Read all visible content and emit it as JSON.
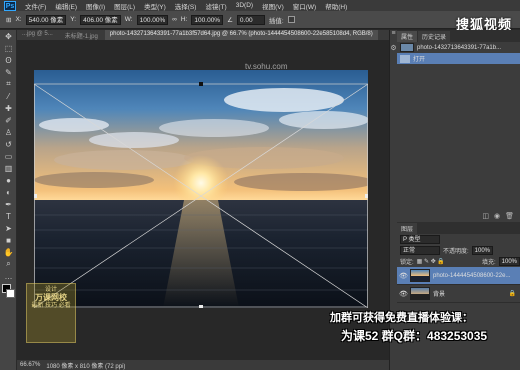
{
  "app": {
    "logo": "Ps"
  },
  "menu": [
    "文件(F)",
    "编辑(E)",
    "图像(I)",
    "图层(L)",
    "类型(Y)",
    "选择(S)",
    "滤镜(T)",
    "3D(D)",
    "视图(V)",
    "窗口(W)",
    "帮助(H)"
  ],
  "options": {
    "x_label": "X:",
    "x_value": "540.00 像素",
    "y_label": "Y:",
    "y_value": "406.00 像素",
    "w_label": "W:",
    "w_value": "100.00%",
    "h_label": "H:",
    "h_value": "100.00%",
    "angle_value": "0.00",
    "interp_label": "插值:",
    "watermark_text": "搜狐视频"
  },
  "watermark_site": "tv.sohu.com",
  "tabs": [
    {
      "label": "...jpg @ 5...",
      "active": false
    },
    {
      "label": "未标题-1.jpg",
      "active": false
    },
    {
      "label": "photo-1432713643391-77a1b3f57d64.jpg @ 66.7% (photo-1444454508600-22e585108d4, RGB/8)",
      "active": true
    }
  ],
  "status": {
    "zoom": "66.67%",
    "doc_size": "1080 像素 x 810 像素 (72 ppi)"
  },
  "history": {
    "tab1": "属性",
    "tab2": "历史记录",
    "items": [
      {
        "label": "photo-1432713643391-77a1b...",
        "selected": false
      },
      {
        "label": "打开",
        "selected": true
      }
    ]
  },
  "layers": {
    "tab": "图层",
    "filter": "P 类型",
    "blend_mode": "正常",
    "opacity_label": "不透明度:",
    "opacity_value": "100%",
    "lock_label": "锁定:",
    "fill_label": "填充:",
    "fill_value": "100%",
    "items": [
      {
        "name": "photo-1444454508600-22e...",
        "selected": true
      },
      {
        "name": "背景",
        "selected": false
      }
    ]
  },
  "promo": {
    "line1": "加群可获得免费直播体验课：",
    "line2": "为课52 群Q群：483253035"
  },
  "badge": {
    "line1": "设计",
    "line2": "万课网校",
    "line3": "最新 技巧 必看"
  },
  "tools": [
    "move-icon",
    "marquee-icon",
    "lasso-icon",
    "quick-select-icon",
    "crop-icon",
    "eyedropper-icon",
    "healing-icon",
    "brush-icon",
    "stamp-icon",
    "history-brush-icon",
    "eraser-icon",
    "gradient-icon",
    "blur-icon",
    "dodge-icon",
    "pen-icon",
    "type-icon",
    "path-select-icon",
    "shape-icon",
    "hand-icon",
    "zoom-icon"
  ],
  "colors": {
    "accent": "#5a7fb5",
    "ps_blue": "#31a8ff"
  }
}
